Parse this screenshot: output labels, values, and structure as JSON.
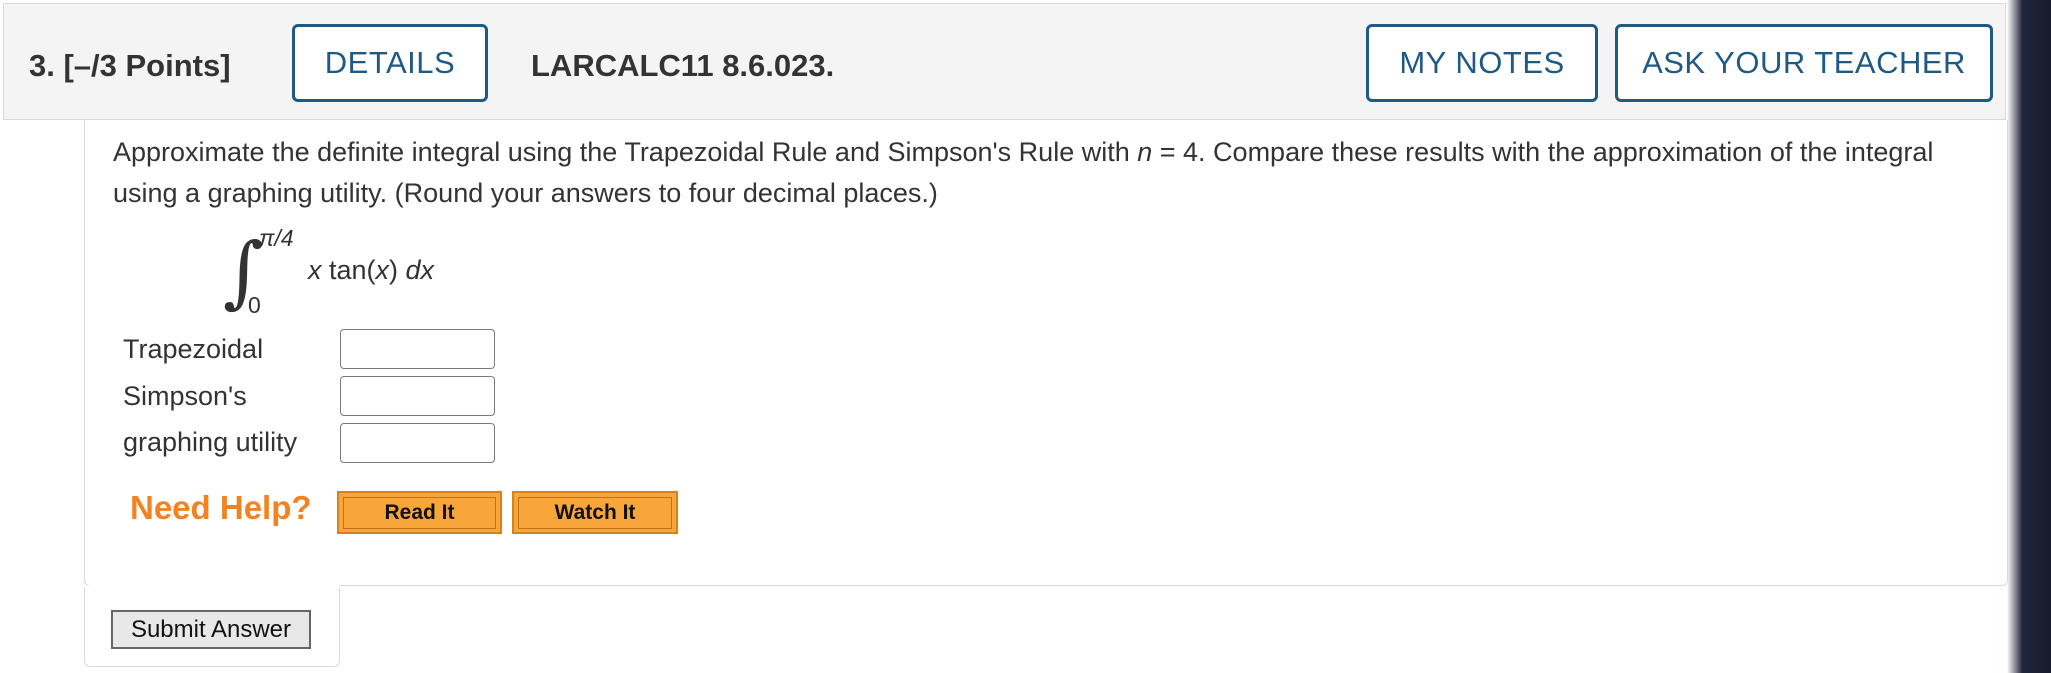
{
  "header": {
    "question": "3.  [–/3 Points]",
    "details_label": "DETAILS",
    "code": "LARCALC11 8.6.023.",
    "my_notes_label": "MY NOTES",
    "ask_teacher_label": "ASK YOUR TEACHER"
  },
  "question": {
    "prompt_part1": "Approximate the definite integral using the Trapezoidal Rule and Simpson's Rule with ",
    "prompt_n": "n",
    "prompt_part2": " = 4. Compare these results with the approximation of the integral using a graphing utility. (Round your answers to four decimal places.)",
    "integral": {
      "sign": "∫",
      "upper": "π/4",
      "lower": "0",
      "x1": "x",
      "func": " tan(",
      "x2": "x",
      "close": ") ",
      "dx": "dx"
    }
  },
  "answers": [
    {
      "label": "Trapezoidal",
      "value": ""
    },
    {
      "label": "Simpson's",
      "value": ""
    },
    {
      "label": "graphing utility",
      "value": ""
    }
  ],
  "help": {
    "need_help": "Need Help?",
    "read_it": "Read It",
    "watch_it": "Watch It"
  },
  "submit_label": "Submit Answer",
  "colors": {
    "accent": "#1f5a85",
    "need_help": "#f58220",
    "help_button": "#f8a53a"
  }
}
